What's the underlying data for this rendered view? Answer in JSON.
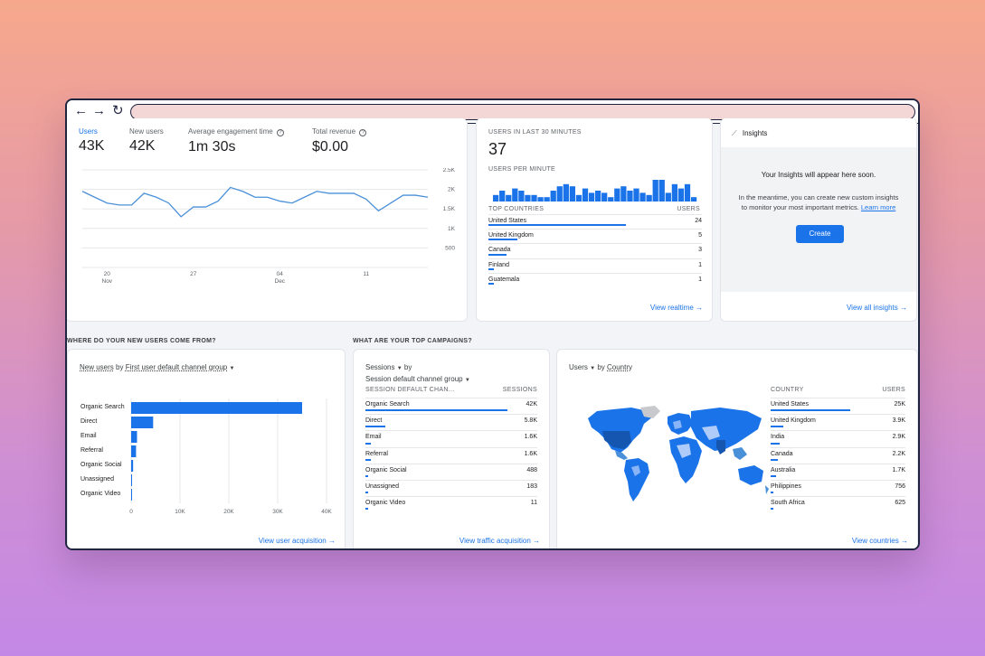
{
  "overview": {
    "metrics": [
      {
        "label": "Users",
        "value": "43K",
        "active": true
      },
      {
        "label": "New users",
        "value": "42K",
        "active": false
      },
      {
        "label": "Average engagement time",
        "value": "1m 30s",
        "active": false
      },
      {
        "label": "Total revenue",
        "value": "$0.00",
        "active": false
      }
    ]
  },
  "realtime": {
    "title": "USERS IN LAST 30 MINUTES",
    "value": "37",
    "per_minute_label": "USERS PER MINUTE",
    "per_minute_values": [
      3,
      5,
      3,
      6,
      5,
      3,
      3,
      2,
      2,
      5,
      7,
      8,
      7,
      3,
      6,
      4,
      5,
      4,
      2,
      6,
      7,
      5,
      6,
      4,
      3,
      10,
      10,
      4,
      8,
      6,
      8,
      2
    ],
    "countries_header": "TOP COUNTRIES",
    "users_header": "USERS",
    "rows": [
      {
        "name": "United States",
        "value": "24",
        "fraction": 1.0
      },
      {
        "name": "United Kingdom",
        "value": "5",
        "fraction": 0.21
      },
      {
        "name": "Canada",
        "value": "3",
        "fraction": 0.13
      },
      {
        "name": "Finland",
        "value": "1",
        "fraction": 0.04
      },
      {
        "name": "Guatemala",
        "value": "1",
        "fraction": 0.04
      }
    ],
    "link": "View realtime"
  },
  "insights": {
    "title": "Insights",
    "heading": "Your Insights will appear here soon.",
    "body_line1": "In the meantime, you can create new custom insights",
    "body_line2": "to monitor your most important metrics.",
    "learn_more": "Learn more",
    "button": "Create",
    "link": "View all insights"
  },
  "acquisition": {
    "section": "WHERE DO YOUR NEW USERS COME FROM?",
    "dropdown_a": "New users",
    "dropdown_mid": " by ",
    "dropdown_b": "First user default channel group",
    "link": "View user acquisition"
  },
  "campaigns": {
    "section": "WHAT ARE YOUR TOP CAMPAIGNS?",
    "dropdown_a": "Sessions",
    "dropdown_mid": "by",
    "dropdown_b": "Session default channel group",
    "col_left": "SESSION DEFAULT CHAN...",
    "col_right": "SESSIONS",
    "rows": [
      {
        "name": "Organic Search",
        "value": "42K",
        "fraction": 1.0
      },
      {
        "name": "Direct",
        "value": "5.8K",
        "fraction": 0.14
      },
      {
        "name": "Email",
        "value": "1.6K",
        "fraction": 0.04
      },
      {
        "name": "Referral",
        "value": "1.6K",
        "fraction": 0.04
      },
      {
        "name": "Organic Social",
        "value": "488",
        "fraction": 0.012
      },
      {
        "name": "Unassigned",
        "value": "183",
        "fraction": 0.005
      },
      {
        "name": "Organic Video",
        "value": "11",
        "fraction": 0.001
      }
    ],
    "link": "View traffic acquisition"
  },
  "countries": {
    "dropdown_a": "Users",
    "dropdown_mid": "by",
    "dropdown_b": "Country",
    "col_left": "COUNTRY",
    "col_right": "USERS",
    "rows": [
      {
        "name": "United States",
        "value": "25K",
        "fraction": 1.0
      },
      {
        "name": "United Kingdom",
        "value": "3.9K",
        "fraction": 0.156
      },
      {
        "name": "India",
        "value": "2.9K",
        "fraction": 0.116
      },
      {
        "name": "Canada",
        "value": "2.2K",
        "fraction": 0.088
      },
      {
        "name": "Australia",
        "value": "1.7K",
        "fraction": 0.068
      },
      {
        "name": "Philippines",
        "value": "756",
        "fraction": 0.03
      },
      {
        "name": "South Africa",
        "value": "625",
        "fraction": 0.025
      }
    ],
    "link": "View countries"
  },
  "chart_data": [
    {
      "type": "line",
      "title": "",
      "x": [
        0,
        1,
        2,
        3,
        4,
        5,
        6,
        7,
        8,
        9,
        10,
        11,
        12,
        13,
        14,
        15,
        16,
        17,
        18,
        19,
        20,
        21,
        22,
        23,
        24,
        25,
        26,
        27,
        28
      ],
      "series": [
        {
          "values": [
            1950,
            1800,
            1650,
            1600,
            1600,
            1900,
            1800,
            1650,
            1300,
            1550,
            1550,
            1700,
            2050,
            1950,
            1800,
            1800,
            1700,
            1650,
            1800,
            1950,
            1900,
            1900,
            1900,
            1750,
            1450,
            1650,
            1850,
            1850,
            1800
          ]
        }
      ],
      "x_tick_labels": [
        {
          "at": 2,
          "label": "20",
          "sub": "Nov"
        },
        {
          "at": 9,
          "label": "27",
          "sub": ""
        },
        {
          "at": 16,
          "label": "04",
          "sub": "Dec"
        },
        {
          "at": 23,
          "label": "11",
          "sub": ""
        }
      ],
      "y_ticks": [
        0,
        500,
        1000,
        1500,
        2000,
        2500
      ],
      "y_tick_labels": [
        "",
        "500",
        "1K",
        "1.5K",
        "2K",
        "2.5K"
      ],
      "ylim": [
        0,
        2500
      ],
      "grid": true,
      "color": "#4a90d9"
    },
    {
      "type": "bar",
      "orientation": "horizontal",
      "title": "",
      "categories": [
        "Organic Search",
        "Direct",
        "Email",
        "Referral",
        "Organic Social",
        "Unassigned",
        "Organic Video"
      ],
      "values": [
        35000,
        4500,
        1200,
        1000,
        400,
        150,
        10
      ],
      "x_ticks": [
        0,
        10000,
        20000,
        30000,
        40000
      ],
      "x_tick_labels": [
        "0",
        "10K",
        "20K",
        "30K",
        "40K"
      ],
      "xlim": [
        0,
        40000
      ],
      "color": "#1a73e8"
    }
  ]
}
